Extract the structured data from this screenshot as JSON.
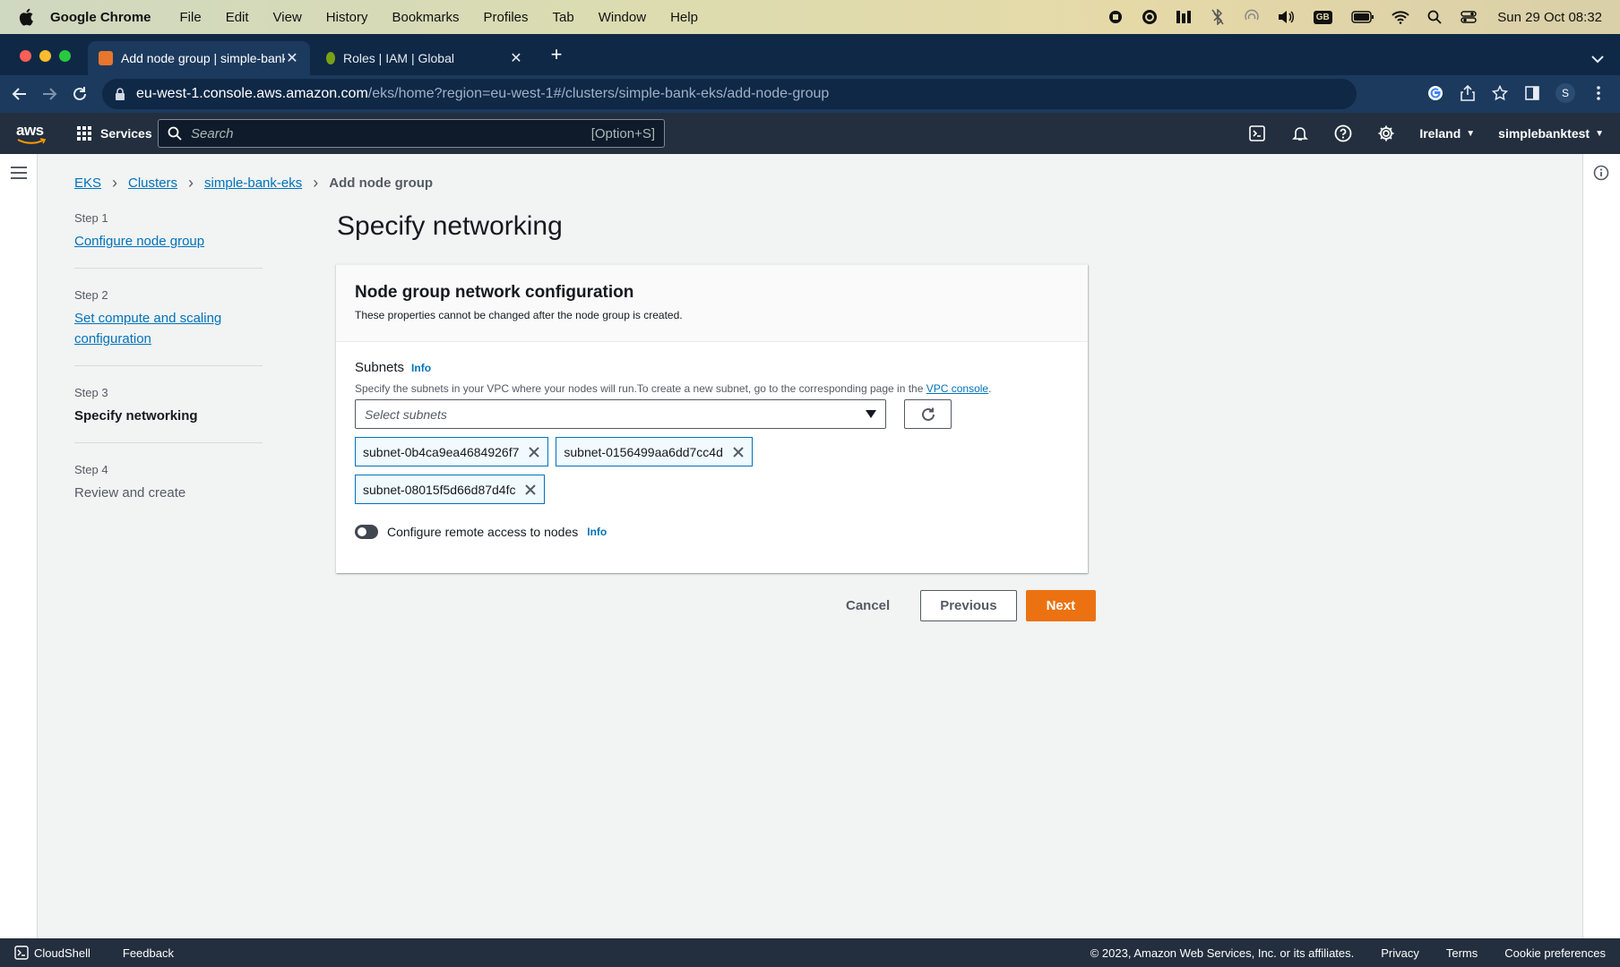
{
  "mac_menubar": {
    "app_name": "Google Chrome",
    "menus": [
      "File",
      "Edit",
      "View",
      "History",
      "Bookmarks",
      "Profiles",
      "Tab",
      "Window",
      "Help"
    ],
    "clock": "Sun 29 Oct  08:32",
    "keyboard_layout": "GB"
  },
  "browser": {
    "tabs": [
      {
        "label": "Add node group | simple-bank",
        "active": true,
        "favicon": "eks-favicon"
      },
      {
        "label": "Roles | IAM | Global",
        "active": false,
        "favicon": "iam-favicon"
      }
    ],
    "url_host": "eu-west-1.console.aws.amazon.com",
    "url_path": "/eks/home?region=eu-west-1#/clusters/simple-bank-eks/add-node-group",
    "profile_initial": "S"
  },
  "aws_header": {
    "logo_text": "aws",
    "services_label": "Services",
    "search_placeholder": "Search",
    "search_shortcut": "[Option+S]",
    "region": "Ireland",
    "account": "simplebanktest"
  },
  "breadcrumb": {
    "items": [
      "EKS",
      "Clusters",
      "simple-bank-eks"
    ],
    "current": "Add node group"
  },
  "steps": [
    {
      "label": "Step 1",
      "title": "Configure node group"
    },
    {
      "label": "Step 2",
      "title": "Set compute and scaling configuration"
    },
    {
      "label": "Step 3",
      "title": "Specify networking"
    },
    {
      "label": "Step 4",
      "title": "Review and create"
    }
  ],
  "page_title": "Specify networking",
  "panel": {
    "title": "Node group network configuration",
    "description": "These properties cannot be changed after the node group is created.",
    "subnets_label": "Subnets",
    "info_label": "Info",
    "subnets_desc": "Specify the subnets in your VPC where your nodes will run.To create a new subnet, go to the corresponding page in the",
    "vpc_console_link": "VPC console",
    "subnets_desc_end": ".",
    "select_placeholder": "Select subnets",
    "selected_subnets": [
      "subnet-0b4ca9ea4684926f7",
      "subnet-0156499aa6dd7cc4d",
      "subnet-08015f5d66d87d4fc"
    ],
    "remote_access_label": "Configure remote access to nodes",
    "remote_access_enabled": false
  },
  "actions": {
    "cancel": "Cancel",
    "previous": "Previous",
    "next": "Next"
  },
  "footer": {
    "cloudshell": "CloudShell",
    "feedback": "Feedback",
    "copyright": "© 2023, Amazon Web Services, Inc. or its affiliates.",
    "privacy": "Privacy",
    "terms": "Terms",
    "cookie": "Cookie preferences"
  },
  "colors": {
    "aws_navy": "#232f3e",
    "link_blue": "#0073bb",
    "primary_orange": "#ec7211",
    "chrome_tabbar": "#0f2846"
  }
}
